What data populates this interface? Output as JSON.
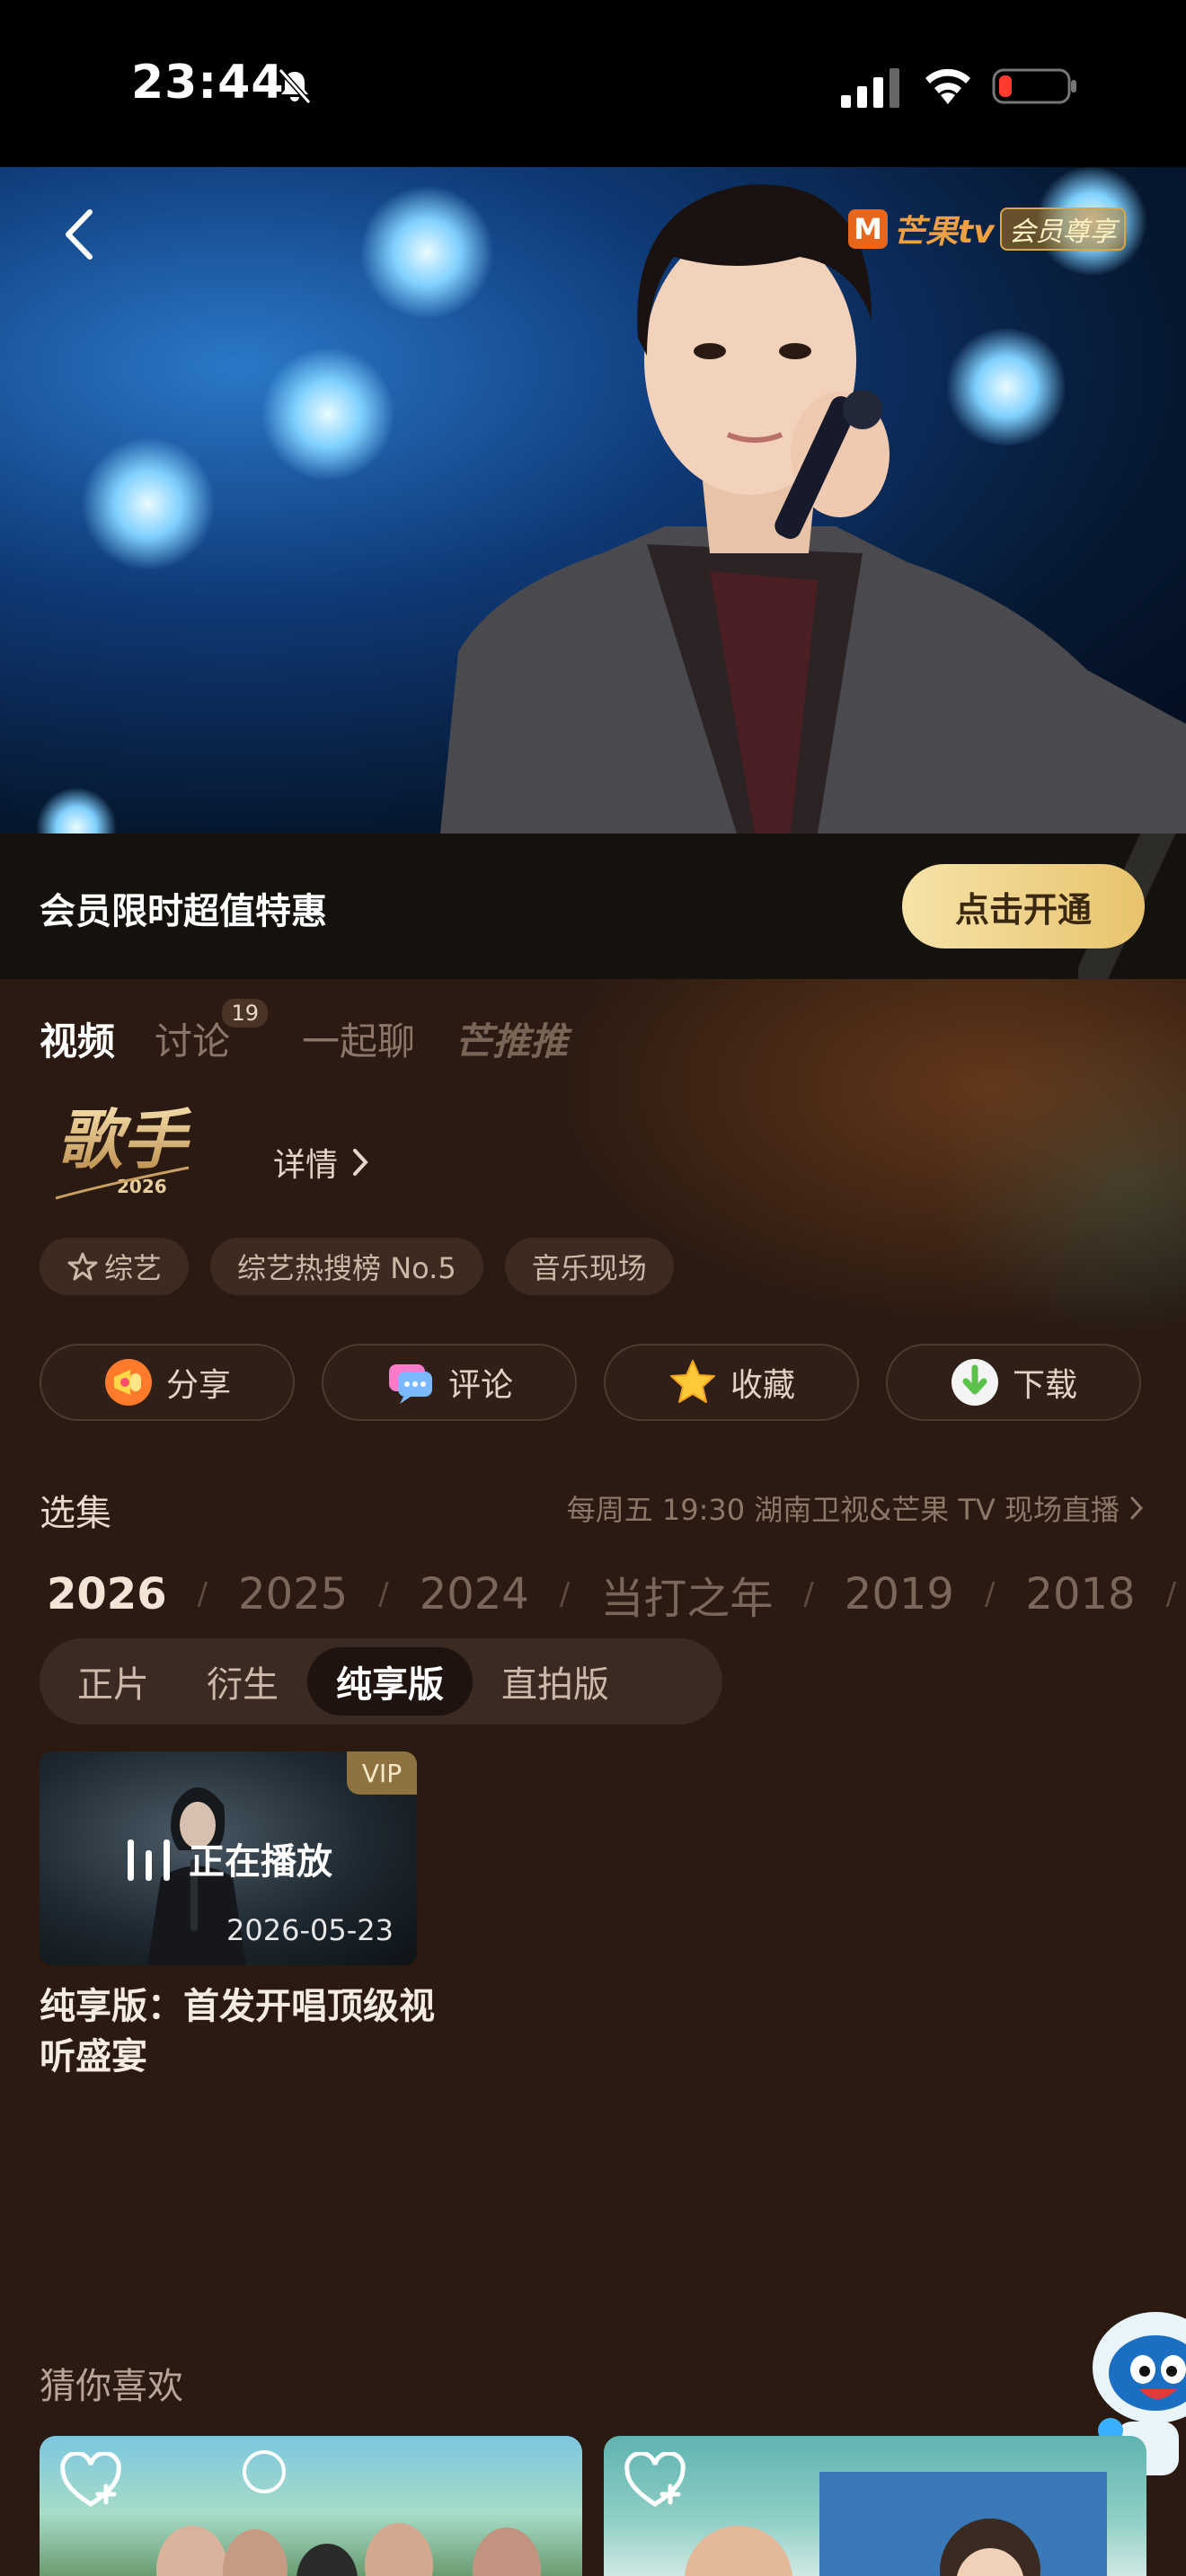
{
  "status_bar": {
    "time": "23:44"
  },
  "hero": {
    "brand_text": "芒果tv",
    "brand_vip": "会员尊享"
  },
  "vip_banner": {
    "text": "会员限时超值特惠",
    "button": "点击开通"
  },
  "tabs": [
    {
      "label": "视频"
    },
    {
      "label": "讨论",
      "badge": "19"
    },
    {
      "label": "一起聊"
    },
    {
      "label": "芒推推"
    }
  ],
  "show": {
    "logo_text": "歌手",
    "logo_year": "2026",
    "detail": "详情"
  },
  "tags": [
    "综艺",
    "综艺热搜榜 No.5",
    "音乐现场"
  ],
  "actions": {
    "share": "分享",
    "comment": "评论",
    "favorite": "收藏",
    "download": "下载"
  },
  "episodes": {
    "title": "选集",
    "schedule": "每周五 19:30 湖南卫视&芒果 TV 现场直播",
    "years": [
      "2026",
      "2025",
      "2024",
      "当打之年",
      "2019",
      "2018"
    ],
    "segments": [
      "正片",
      "衍生",
      "纯享版",
      "直拍版"
    ],
    "current": {
      "vip": "VIP",
      "status": "正在播放",
      "date": "2026-05-23",
      "title": "纯享版：首发开唱顶级视听盛宴"
    }
  },
  "recommend": {
    "title": "猜你喜欢"
  },
  "colors": {
    "accent_gold": "#e8c36d",
    "background": "#2a1a12"
  }
}
